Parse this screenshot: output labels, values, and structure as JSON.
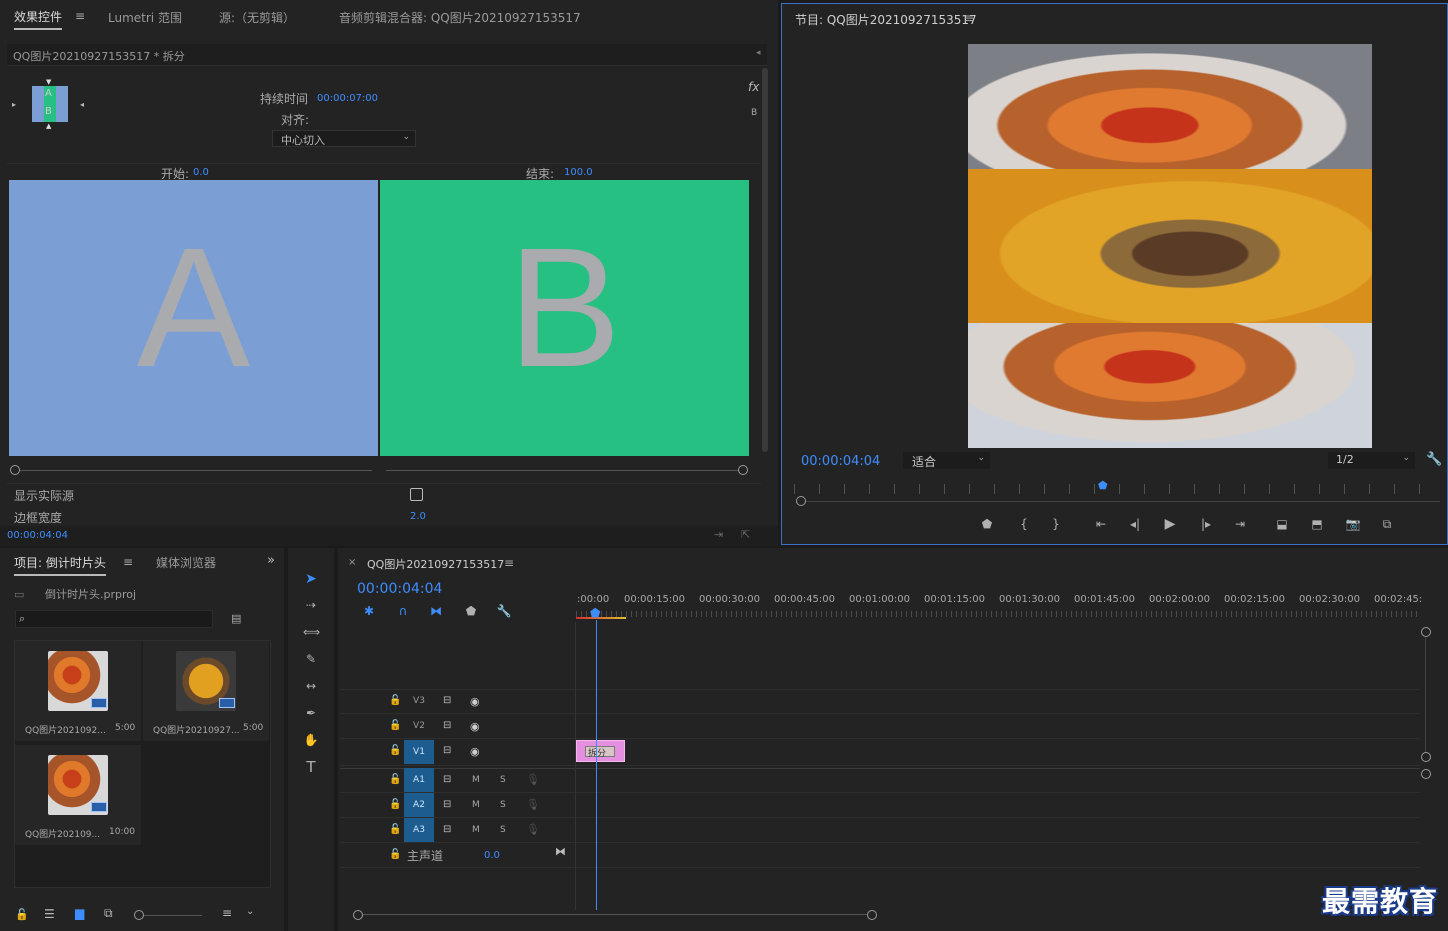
{
  "effects_panel": {
    "tabs": [
      "效果控件",
      "Lumetri 范围",
      "源:（无剪辑）",
      "音频剪辑混合器: QQ图片20210927153517"
    ],
    "clip_header": "QQ图片20210927153517 * 拆分",
    "duration_label": "持续时间",
    "duration_value": "00:00:07:00",
    "align_label": "对齐:",
    "align_value": "中心切入",
    "fx_label": "fx",
    "b_label": "B",
    "start_label": "开始:",
    "start_value": "0.0",
    "end_label": "结束:",
    "end_value": "100.0",
    "preview_a": "A",
    "preview_b": "B",
    "thumb_a": "A",
    "thumb_b": "B",
    "show_source_label": "显示实际源",
    "border_width_label": "边框宽度",
    "border_width_value": "2.0",
    "timecode": "00:00:04:04"
  },
  "program_monitor": {
    "title": "节目: QQ图片20210927153517",
    "timecode": "00:00:04:04",
    "fit_value": "适合",
    "resolution_value": "1/2"
  },
  "project_panel": {
    "tabs": [
      "项目: 倒计时片头",
      "媒体浏览器"
    ],
    "project_file": "倒计时片头.prproj",
    "search_placeholder": "",
    "items": [
      {
        "name": "QQ图片2021092...",
        "duration": "5:00"
      },
      {
        "name": "QQ图片20210927...",
        "duration": "5:00"
      },
      {
        "name": "QQ图片202109...",
        "duration": "10:00"
      }
    ]
  },
  "timeline": {
    "title": "QQ图片20210927153517",
    "timecode": "00:00:04:04",
    "ruler_labels": [
      ":00:00",
      "00:00:15:00",
      "00:00:30:00",
      "00:00:45:00",
      "00:01:00:00",
      "00:01:15:00",
      "00:01:30:00",
      "00:01:45:00",
      "00:02:00:00",
      "00:02:15:00",
      "00:02:30:00",
      "00:02:45:"
    ],
    "video_tracks": [
      "V3",
      "V2",
      "V1"
    ],
    "audio_tracks": [
      "A1",
      "A2",
      "A3"
    ],
    "mute_label": "M",
    "solo_label": "S",
    "master_label": "主声道",
    "master_value": "0.0",
    "clip_label": "拆分"
  },
  "watermark": "最需教育",
  "colors": {
    "accent_blue": "#3d8dff",
    "panel_a": "#7b9fd4",
    "panel_b": "#27c083",
    "clip_pink": "#e58fe0",
    "track_active": "#1d5c8f"
  }
}
